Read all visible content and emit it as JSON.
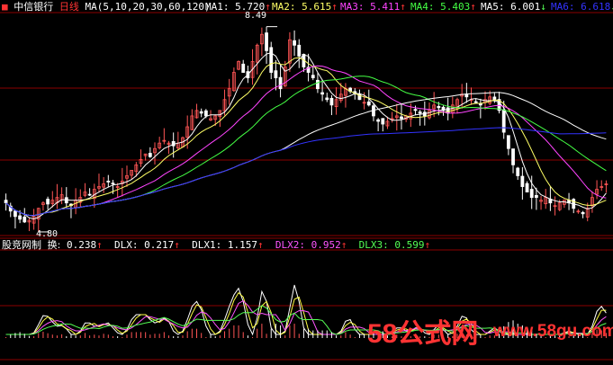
{
  "colors": {
    "background": "#000000",
    "grid": "#8b0000",
    "candle_up": "#ff5555",
    "candle_down": "#ffffff",
    "ma1": "#ffffff",
    "ma2": "#ffff66",
    "ma3": "#ff44ff",
    "ma4": "#44ff44",
    "ma5": "#ffffff",
    "ma6": "#3333ff",
    "header_text": "#ffffff",
    "ind_white": "#ffffff",
    "ind_yellow": "#ffff44",
    "ind_magenta": "#ff55ff",
    "ind_green": "#55ff55",
    "watermark": "#ff3333"
  },
  "main_header": {
    "stock_name": "中信银行",
    "period": "日线",
    "ma_params": "MA(5,10,20,30,60,120)",
    "ma1": {
      "label": "MA1:",
      "value": "5.720",
      "arrow": "↑"
    },
    "ma2": {
      "label": "MA2:",
      "value": "5.615",
      "arrow": "↑"
    },
    "ma3": {
      "label": "MA3:",
      "value": "5.411",
      "arrow": "↑"
    },
    "ma4": {
      "label": "MA4:",
      "value": "5.403",
      "arrow": "↑"
    },
    "ma5": {
      "label": "MA5:",
      "value": "6.001",
      "arrow": "↓"
    },
    "ma6": {
      "label": "MA6:",
      "value": "6.618",
      "arrow": "↓"
    }
  },
  "price_annotations": {
    "high": "8.49",
    "low": "4.80"
  },
  "indicator_header": {
    "name": "股竞网制",
    "item1": {
      "label": "换:",
      "value": "0.238",
      "arrow": "↑"
    },
    "item2": {
      "label": "DLX:",
      "value": "0.217",
      "arrow": "↑"
    },
    "item3": {
      "label": "DLX1:",
      "value": "1.157",
      "arrow": "↑"
    },
    "item4": {
      "label": "DLX2:",
      "value": "0.952",
      "arrow": "↑"
    },
    "item5": {
      "label": "DLX3:",
      "value": "0.599",
      "arrow": "↑"
    }
  },
  "watermark": {
    "brand_num": "58",
    "brand_cn": "公式网",
    "url": "www.58gu.com"
  },
  "chart_data": {
    "type": "candlestick",
    "count": 130,
    "high_label": "8.49",
    "low_label": "4.80",
    "close": [
      5.2,
      5.05,
      4.95,
      4.9,
      4.85,
      4.88,
      4.95,
      5.1,
      5.2,
      5.18,
      5.25,
      5.3,
      5.35,
      5.2,
      5.15,
      5.25,
      5.3,
      5.4,
      5.35,
      5.45,
      5.5,
      5.55,
      5.6,
      5.55,
      5.5,
      5.6,
      5.7,
      5.8,
      5.9,
      6.0,
      6.1,
      6.05,
      6.2,
      6.3,
      6.35,
      6.3,
      6.25,
      6.3,
      6.4,
      6.6,
      6.8,
      6.9,
      6.85,
      6.8,
      6.75,
      6.8,
      6.9,
      7.1,
      7.3,
      7.6,
      7.8,
      7.6,
      7.5,
      7.8,
      8.1,
      8.3,
      8.0,
      7.6,
      7.5,
      7.3,
      7.7,
      8.2,
      8.1,
      7.9,
      7.7,
      7.6,
      7.5,
      7.3,
      7.2,
      7.1,
      7.0,
      7.1,
      7.2,
      7.3,
      7.25,
      7.2,
      7.1,
      7.05,
      7.0,
      6.8,
      6.7,
      6.65,
      6.7,
      6.75,
      6.8,
      6.75,
      6.8,
      6.85,
      6.9,
      6.85,
      6.8,
      6.9,
      7.0,
      6.95,
      6.9,
      6.85,
      7.0,
      7.1,
      7.2,
      7.15,
      7.1,
      7.05,
      7.0,
      7.1,
      7.15,
      7.1,
      6.9,
      6.5,
      6.2,
      5.9,
      5.7,
      5.5,
      5.4,
      5.3,
      5.3,
      5.25,
      5.3,
      5.2,
      5.15,
      5.2,
      5.25,
      5.2,
      5.1,
      5.05,
      5.0,
      5.1,
      5.3,
      5.45,
      5.5,
      5.55
    ],
    "series": [
      {
        "name": "MA1",
        "values": "computed"
      },
      {
        "name": "MA2",
        "values": "computed"
      },
      {
        "name": "MA3",
        "values": "computed"
      },
      {
        "name": "MA4",
        "values": "computed"
      },
      {
        "name": "MA5",
        "values": "computed"
      },
      {
        "name": "MA6",
        "values": "computed"
      }
    ]
  }
}
